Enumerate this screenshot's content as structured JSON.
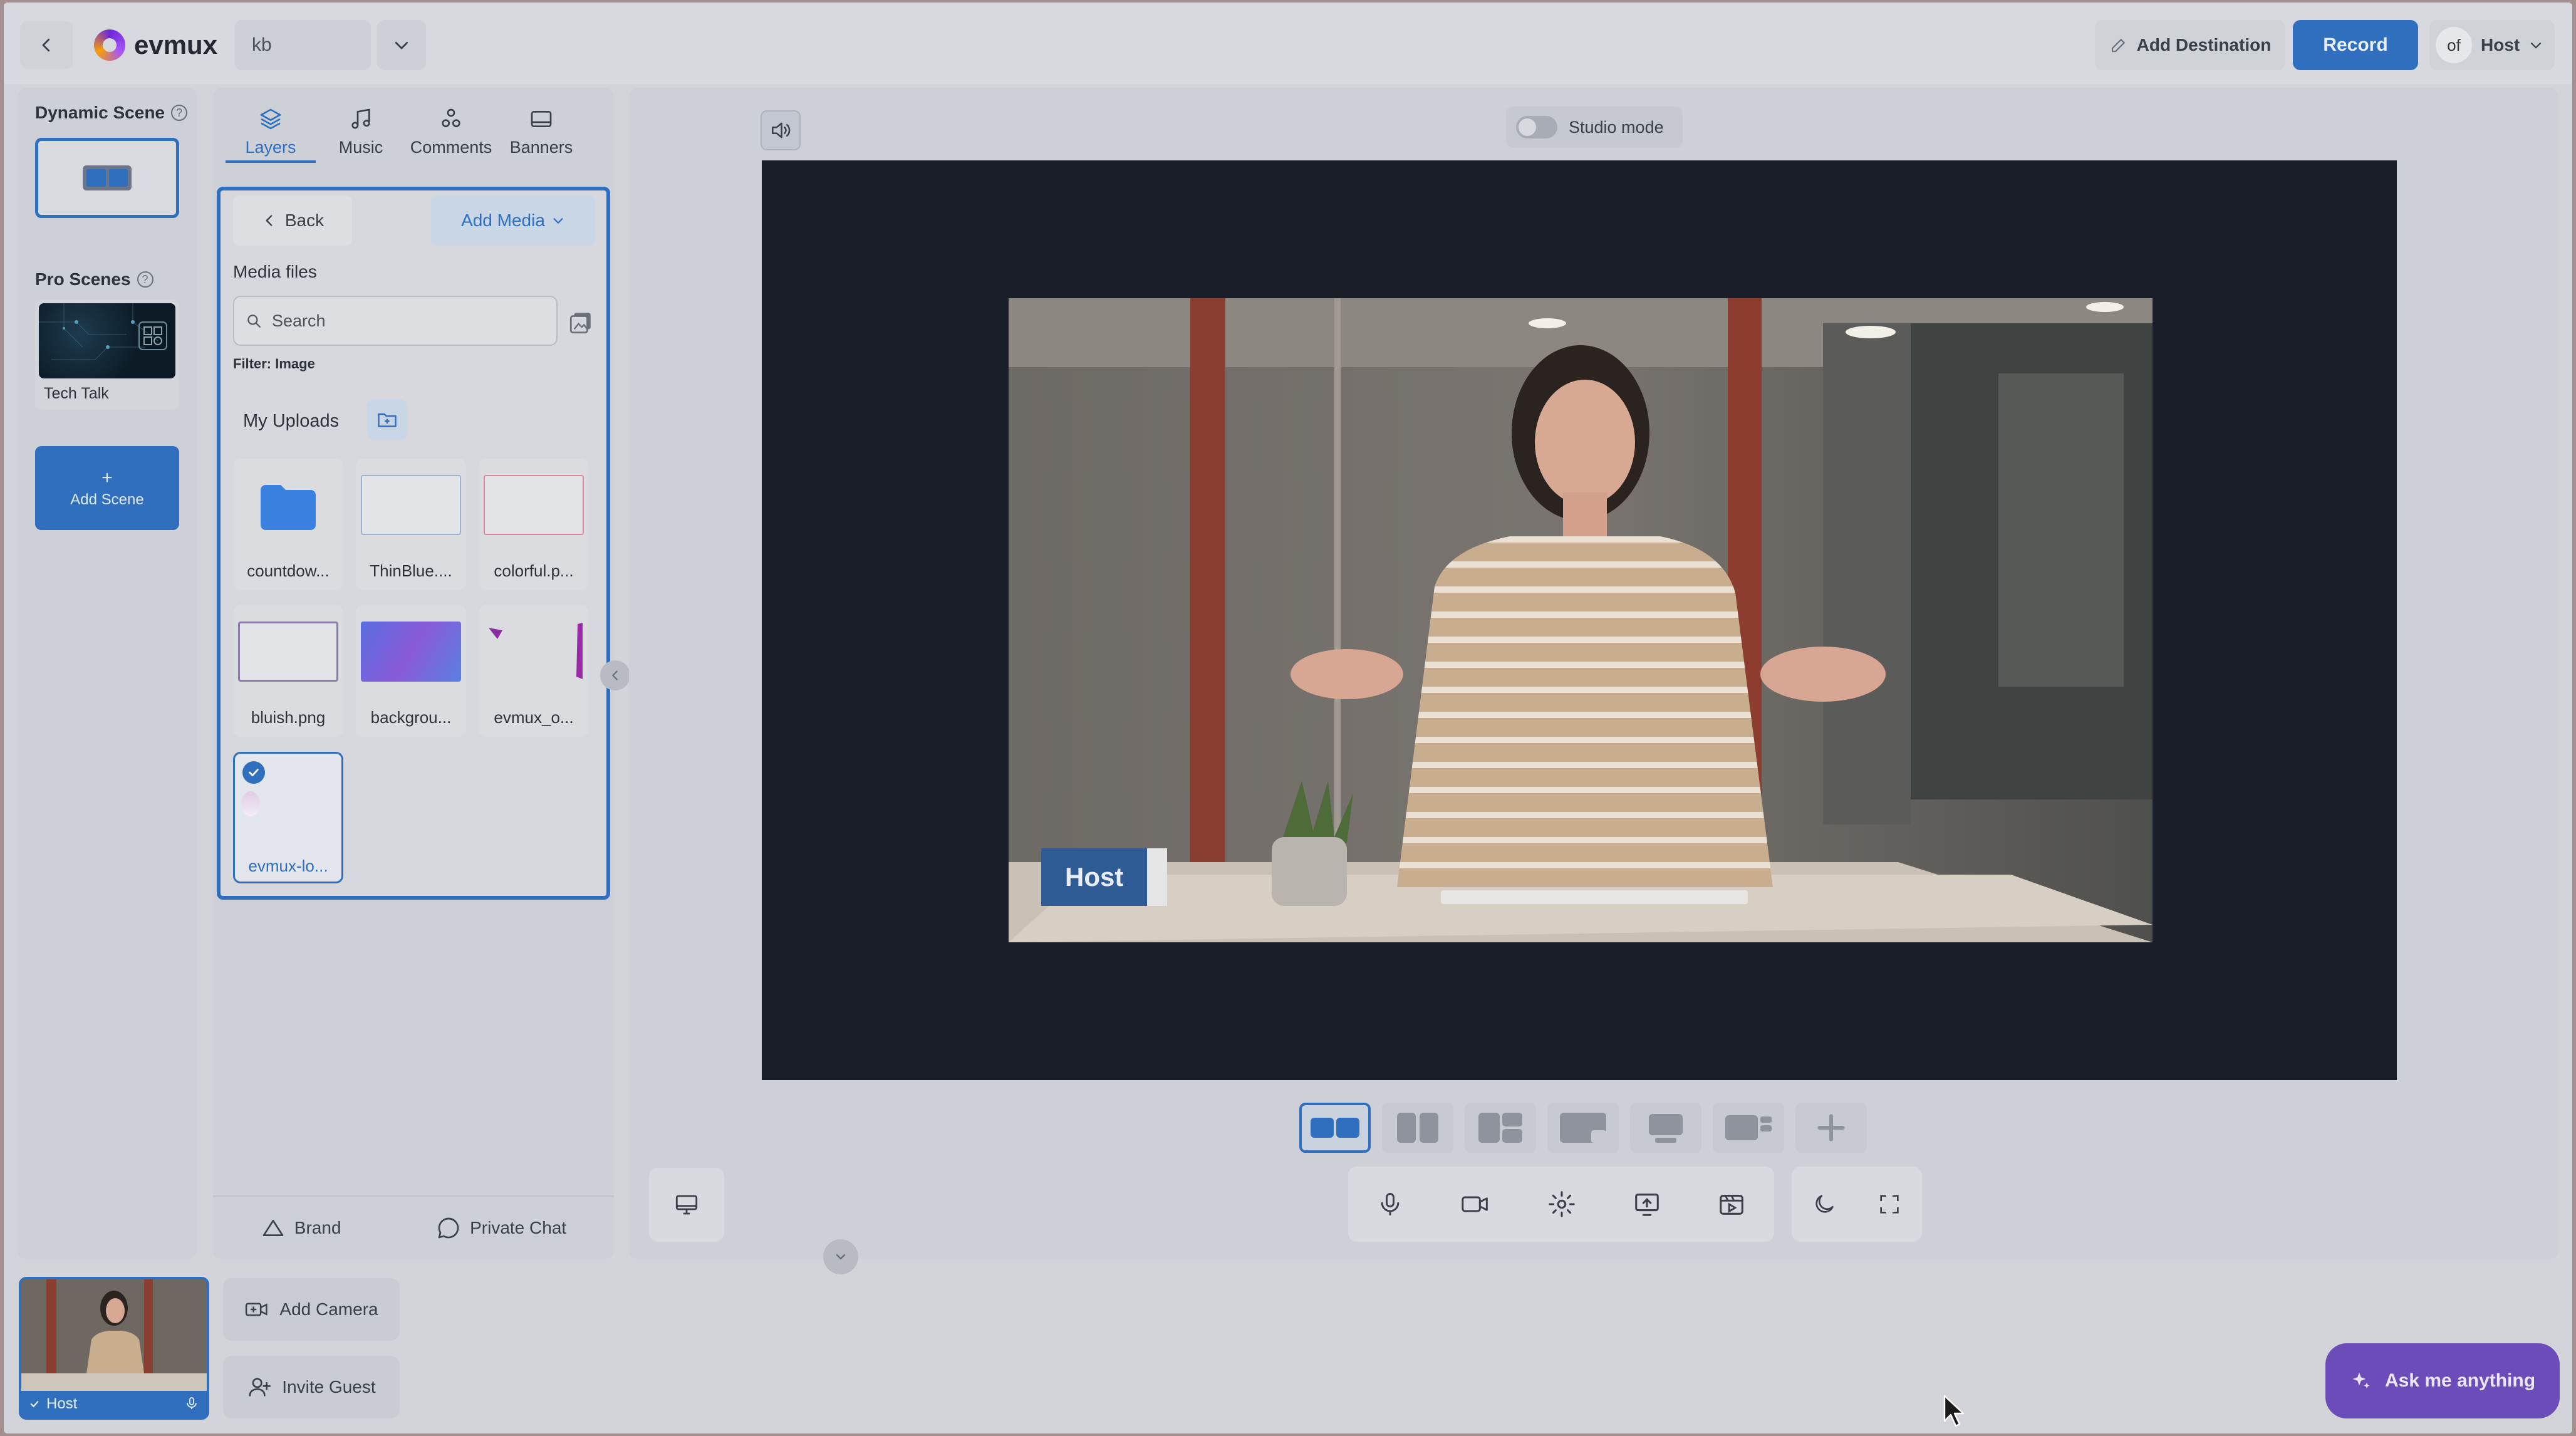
{
  "header": {
    "brand": "evmux",
    "title_value": "kb",
    "add_destination": "Add Destination",
    "record": "Record",
    "host_label": "Host",
    "avatar_text": "of"
  },
  "scenes": {
    "dynamic_label": "Dynamic Scene",
    "pro_label": "Pro Scenes",
    "pro_item": "Tech Talk",
    "add_scene": "Add Scene"
  },
  "tabs": [
    {
      "label": "Layers",
      "icon": "layers-icon"
    },
    {
      "label": "Music",
      "icon": "music-icon"
    },
    {
      "label": "Comments",
      "icon": "comments-icon"
    },
    {
      "label": "Banners",
      "icon": "banners-icon"
    }
  ],
  "media": {
    "back": "Back",
    "add_media": "Add Media",
    "title": "Media files",
    "search_placeholder": "Search",
    "filter": "Filter: Image",
    "uploads": "My Uploads",
    "files": [
      {
        "name": "countdow..."
      },
      {
        "name": "ThinBlue...."
      },
      {
        "name": "colorful.p..."
      },
      {
        "name": "bluish.png"
      },
      {
        "name": "backgrou..."
      },
      {
        "name": "evmux_o..."
      },
      {
        "name": "evmux-lo..."
      }
    ]
  },
  "panel_footer": {
    "brand": "Brand",
    "private_chat": "Private Chat"
  },
  "stage": {
    "studio_mode": "Studio mode",
    "host_tag": "Host"
  },
  "bottom": {
    "cam_label": "Host",
    "add_camera": "Add Camera",
    "invite_guest": "Invite Guest",
    "ask": "Ask me anything"
  },
  "colors": {
    "accent": "#2f6fbd",
    "ask": "#6c4cb8",
    "canvas": "#191e28"
  }
}
